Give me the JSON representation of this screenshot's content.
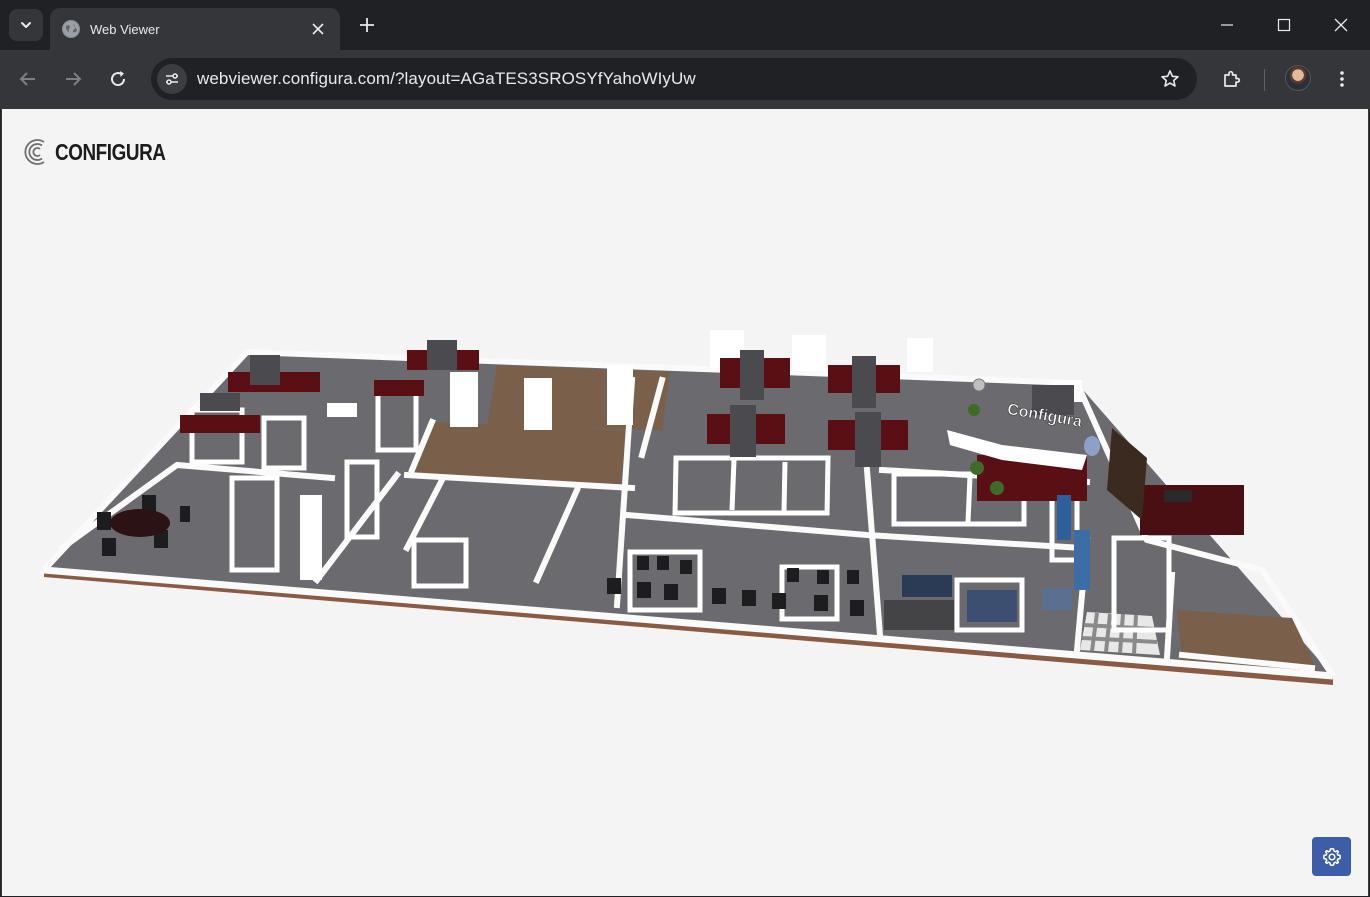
{
  "browser": {
    "tab_title": "Web Viewer",
    "url": "webviewer.configura.com/?layout=AGaTES3SROSYfYahoWIyUw",
    "icons": {
      "tab_search": "chevron-down-icon",
      "favicon": "globe-icon",
      "tab_close": "close-icon",
      "new_tab": "plus-icon",
      "minimize": "minimize-icon",
      "maximize": "maximize-icon",
      "close": "close-icon",
      "back": "back-arrow-icon",
      "forward": "forward-arrow-icon",
      "reload": "reload-icon",
      "site_info": "tune-icon",
      "bookmark": "star-icon",
      "extensions": "puzzle-icon",
      "profile": "avatar-icon",
      "menu": "more-vert-icon"
    }
  },
  "page": {
    "logo_text": "CONFIGURA",
    "scene_sign_text": "Configura",
    "settings_icon": "gear-icon",
    "colors": {
      "background": "#f4f4f4",
      "floor": "#6b6a6e",
      "wood": "#7a604a",
      "accent_red": "#5a0f14",
      "settings_button": "#3e5da8"
    }
  }
}
